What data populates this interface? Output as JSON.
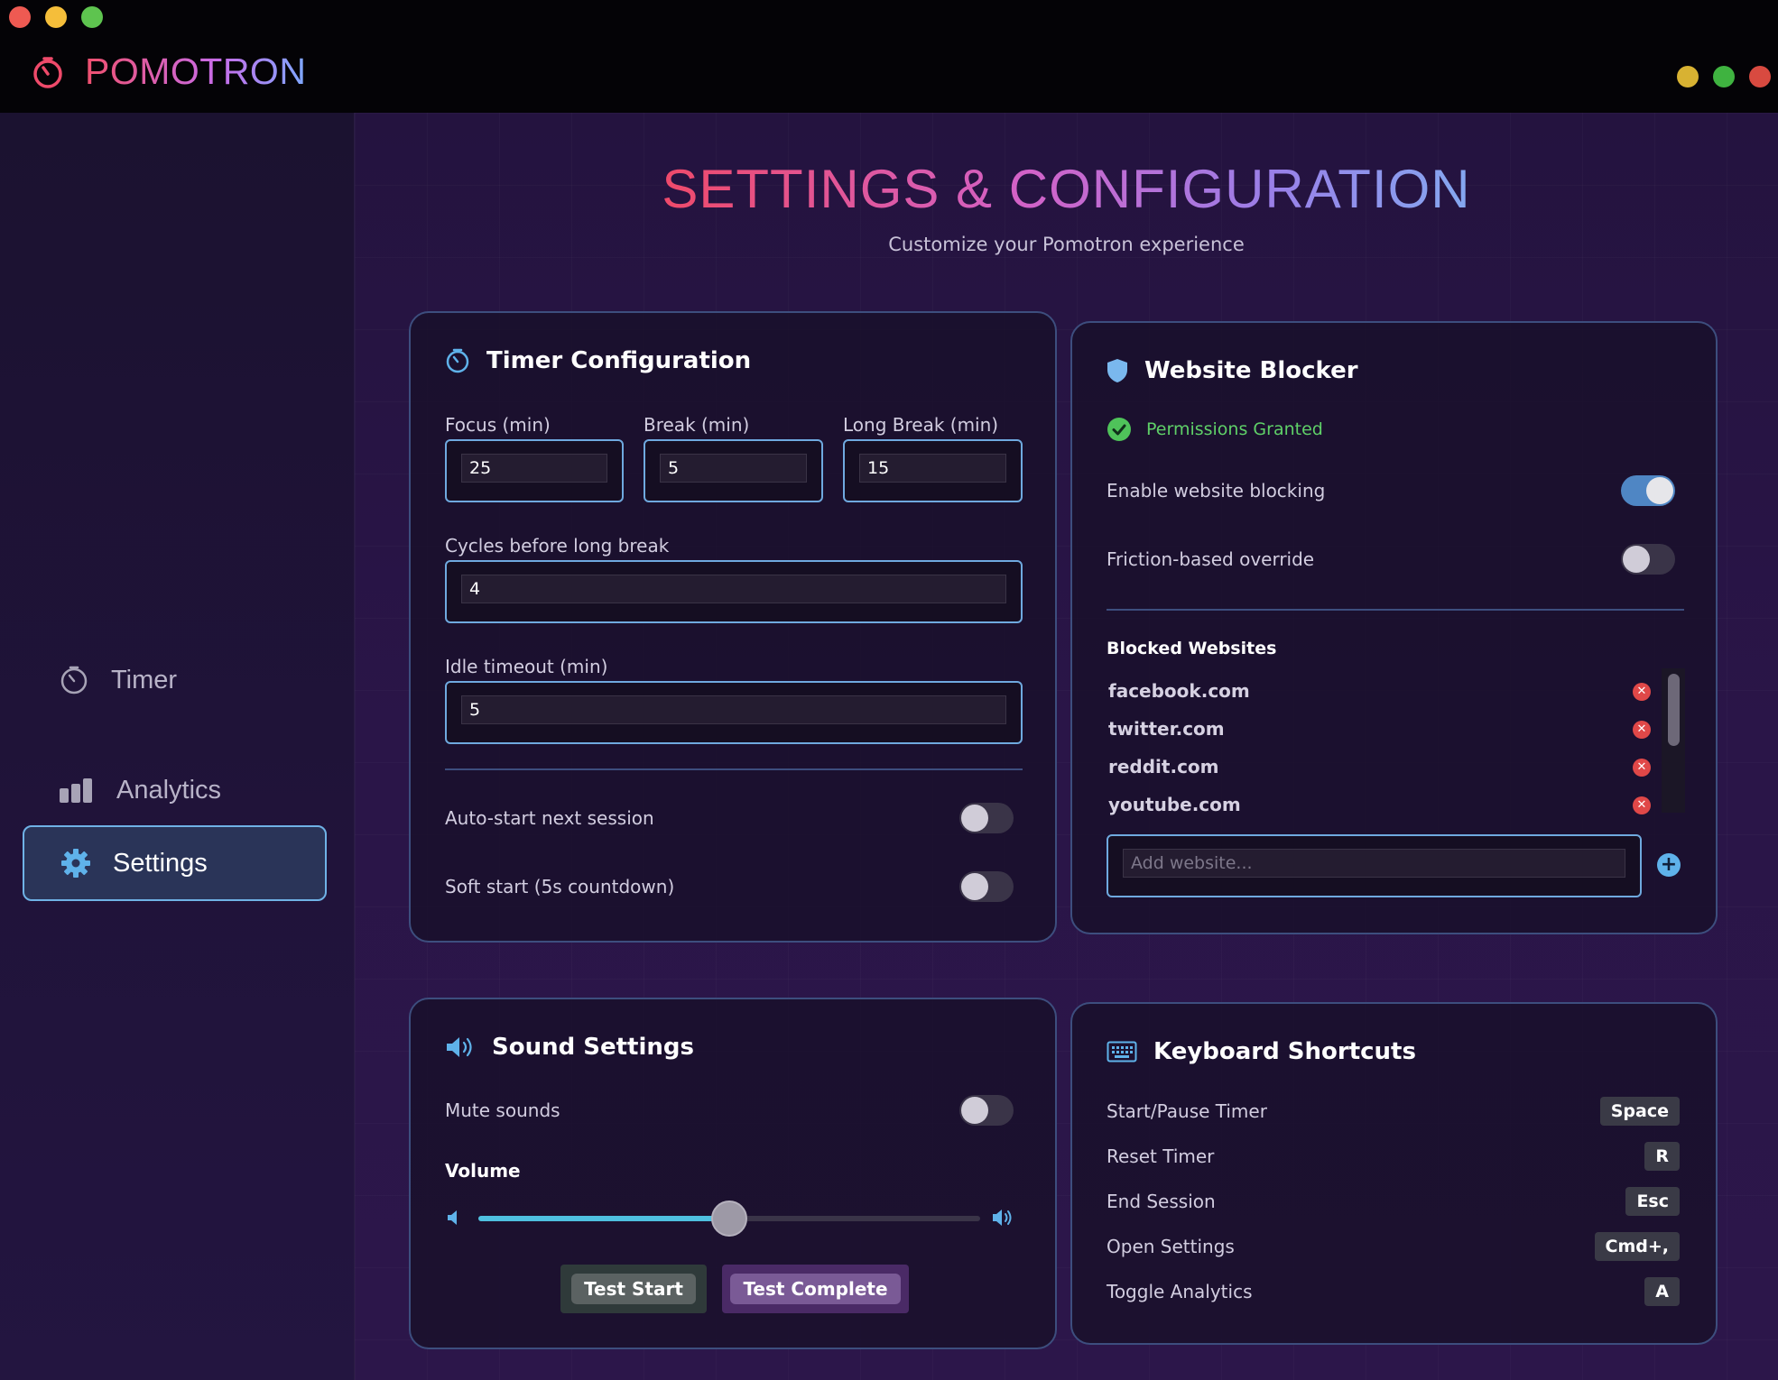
{
  "app": {
    "name": "POMOTRON",
    "traffic_colors": [
      "#ee5a52",
      "#f5be3a",
      "#5ec44f"
    ],
    "window_dot_colors": [
      "#d8b232",
      "#3fb340",
      "#d84a40"
    ]
  },
  "sidebar": {
    "items": [
      {
        "label": "Timer",
        "icon": "timer-icon",
        "active": false
      },
      {
        "label": "Analytics",
        "icon": "bar-chart-icon",
        "active": false
      },
      {
        "label": "Settings",
        "icon": "gear-icon",
        "active": true
      }
    ]
  },
  "page": {
    "title": "SETTINGS & CONFIGURATION",
    "subtitle": "Customize your Pomotron experience"
  },
  "timer_config": {
    "title": "Timer Configuration",
    "focus_label": "Focus (min)",
    "focus_value": "25",
    "break_label": "Break (min)",
    "break_value": "5",
    "long_break_label": "Long Break (min)",
    "long_break_value": "15",
    "cycles_label": "Cycles before long break",
    "cycles_value": "4",
    "idle_label": "Idle timeout (min)",
    "idle_value": "5",
    "auto_start_label": "Auto-start next session",
    "auto_start_on": false,
    "soft_start_label": "Soft start (5s countdown)",
    "soft_start_on": false
  },
  "website_blocker": {
    "title": "Website Blocker",
    "permission_text": "Permissions Granted",
    "enable_label": "Enable website blocking",
    "enable_on": true,
    "friction_label": "Friction-based override",
    "friction_on": false,
    "blocked_heading": "Blocked Websites",
    "sites": [
      "facebook.com",
      "twitter.com",
      "reddit.com",
      "youtube.com"
    ],
    "add_placeholder": "Add website..."
  },
  "sound": {
    "title": "Sound Settings",
    "mute_label": "Mute sounds",
    "mute_on": false,
    "volume_label": "Volume",
    "volume_fraction": 0.5,
    "test_start_label": "Test Start",
    "test_complete_label": "Test Complete"
  },
  "shortcuts": {
    "title": "Keyboard Shortcuts",
    "items": [
      {
        "action": "Start/Pause Timer",
        "key": "Space"
      },
      {
        "action": "Reset Timer",
        "key": "R"
      },
      {
        "action": "End Session",
        "key": "Esc"
      },
      {
        "action": "Open Settings",
        "key": "Cmd+,"
      },
      {
        "action": "Toggle Analytics",
        "key": "A"
      }
    ]
  },
  "colors": {
    "accent_blue": "#6fb2e6",
    "success_green": "#4fc35a",
    "danger_red": "#e04848"
  }
}
